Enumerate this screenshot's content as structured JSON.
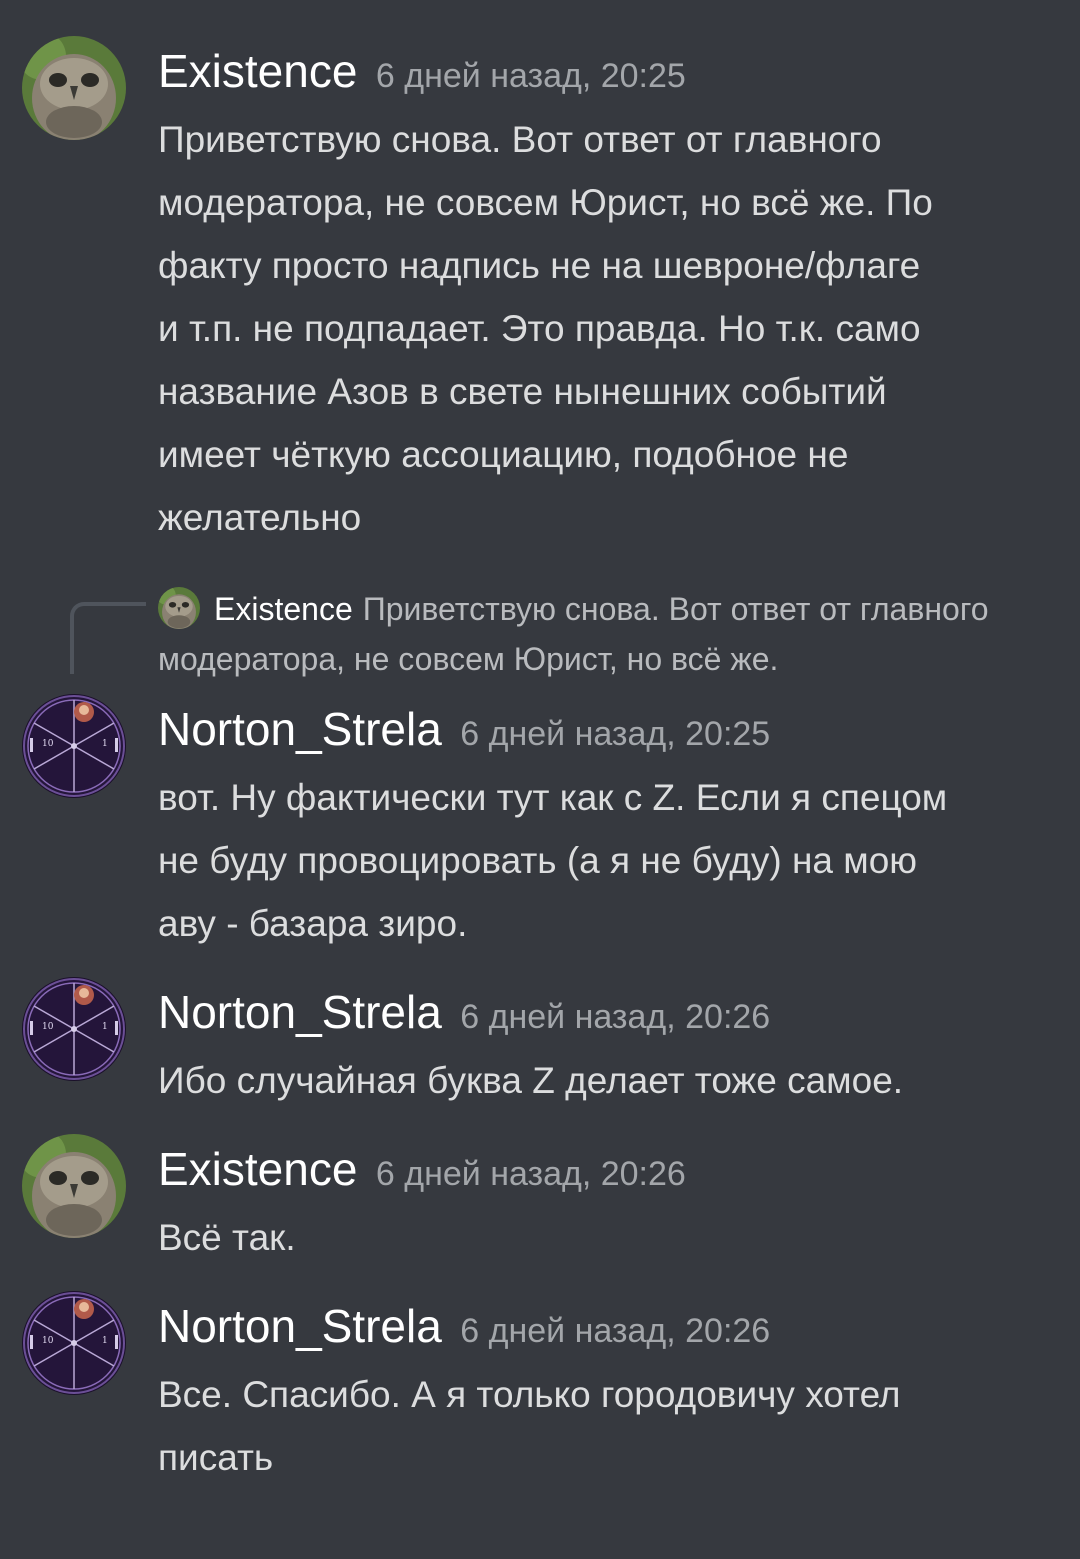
{
  "messages": [
    {
      "author": "Existence",
      "time": "6 дней назад, 20:25",
      "text": "Приветствую снова. Вот ответ от главного\nмодератора, не совсем Юрист, но всё же. По\nфакту просто надпись не на шевроне/флаге\nи т.п. не подпадает. Это правда. Но т.к. само\nназвание Азов в свете нынешних событий\nимеет чёткую ассоциацию, подобное не\nжелательно"
    },
    {
      "reply": {
        "author": "Existence",
        "text": "Приветствую снова. Вот ответ от главного модератора, не совсем Юрист, но всё же."
      },
      "author": "Norton_Strela",
      "time": "6 дней назад, 20:25",
      "text": "вот. Ну фактически тут как с Z. Если я спецом\nне буду провоцировать (а я не буду) на мою\nаву - базара зиро."
    },
    {
      "author": "Norton_Strela",
      "time": "6 дней назад, 20:26",
      "text": "Ибо случайная буква Z делает тоже самое."
    },
    {
      "author": "Existence",
      "time": "6 дней назад, 20:26",
      "text": "Всё так."
    },
    {
      "author": "Norton_Strela",
      "time": "6 дней назад, 20:26",
      "text": "Все. Спасибо. А я только городовичу хотел\nписать"
    }
  ],
  "colors": {
    "background": "#36393f",
    "username": "#ffffff",
    "timestamp": "#a3a6aa",
    "text": "#dcddde",
    "reply_text": "#b9bbbe"
  }
}
